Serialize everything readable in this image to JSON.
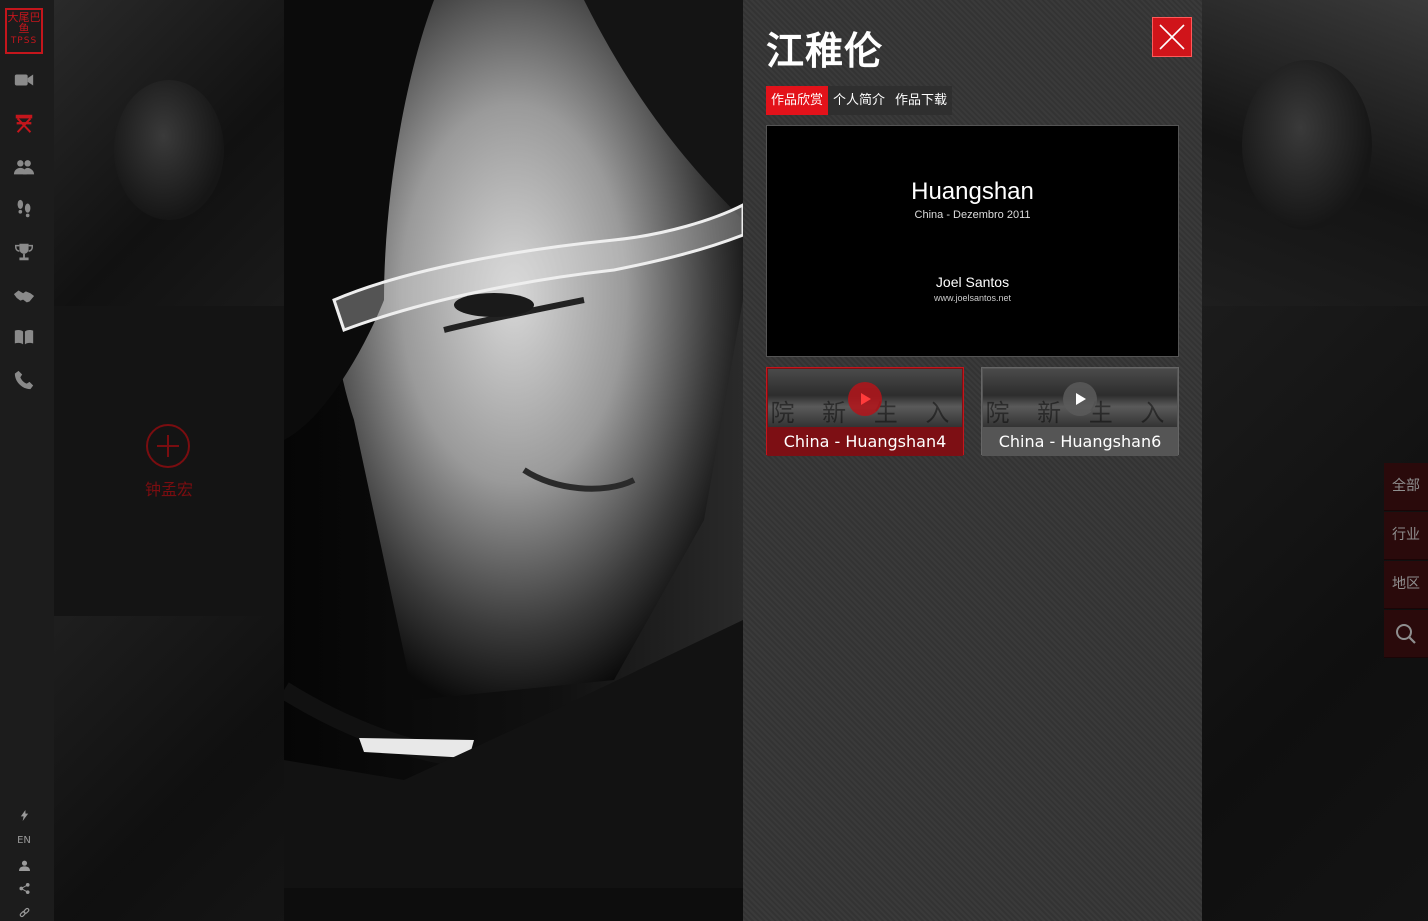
{
  "sidebar": {
    "logo_text": "大尾巴鱼",
    "logo_sub": "TPSS",
    "nav_icons": [
      "video-camera-icon",
      "director-chair-icon",
      "people-icon",
      "footprints-icon",
      "trophy-icon",
      "handshake-icon",
      "book-icon",
      "phone-icon"
    ],
    "active_color": "#c4161c",
    "bottom": {
      "lang": "EN"
    }
  },
  "featured": {
    "name": "钟孟宏"
  },
  "panel": {
    "artist_name": "江稚伦",
    "tabs": [
      {
        "label": "作品欣赏",
        "active": true
      },
      {
        "label": "个人简介",
        "active": false
      },
      {
        "label": "作品下载",
        "active": false
      }
    ],
    "video": {
      "title": "Huangshan",
      "subtitle": "China - Dezembro 2011",
      "author": "Joel Santos",
      "site": "www.joelsantos.net"
    },
    "thumbnails": [
      {
        "caption": "China - Huangshan4",
        "selected": true
      },
      {
        "caption": "China - Huangshan6",
        "selected": false
      }
    ],
    "thumb_chars": "院 新 生 入"
  },
  "filters": {
    "all": "全部",
    "industry": "行业",
    "region": "地区"
  },
  "colors": {
    "accent": "#e3121a",
    "sidebar": "#1c1c1c",
    "panel": "#383838"
  }
}
